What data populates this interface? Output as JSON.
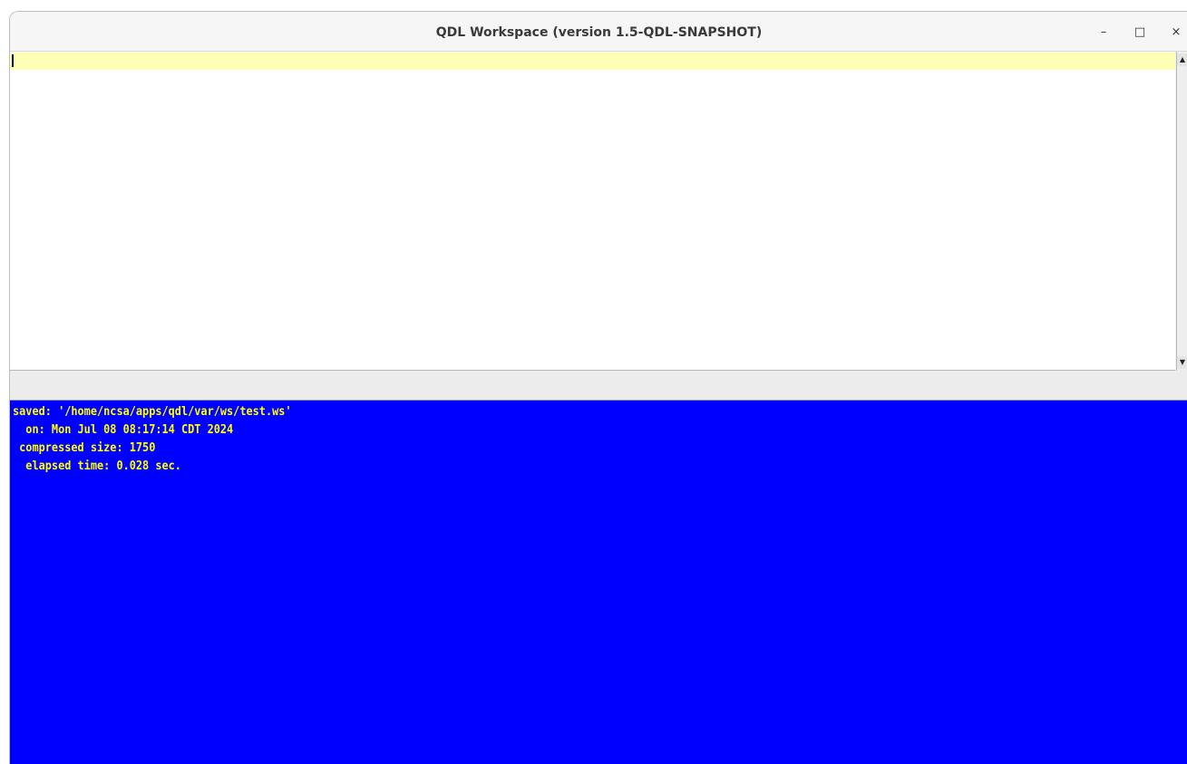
{
  "window": {
    "title": "QDL Workspace (version 1.5-QDL-SNAPSHOT)",
    "controls": {
      "minimize": "–",
      "maximize": "□",
      "close": "×"
    }
  },
  "editor": {
    "value": "",
    "scroll_up_icon": "▲",
    "scroll_down_icon": "▼"
  },
  "output": {
    "lines": [
      "saved: '/home/ncsa/apps/qdl/var/ws/test.ws'",
      "  on: Mon Jul 08 08:17:14 CDT 2024",
      " compressed size: 1750",
      "  elapsed time: 0.028 sec."
    ]
  },
  "colors": {
    "output_background": "#0000ff",
    "output_text": "#ffff00",
    "current_line_highlight": "#ffffb3"
  }
}
